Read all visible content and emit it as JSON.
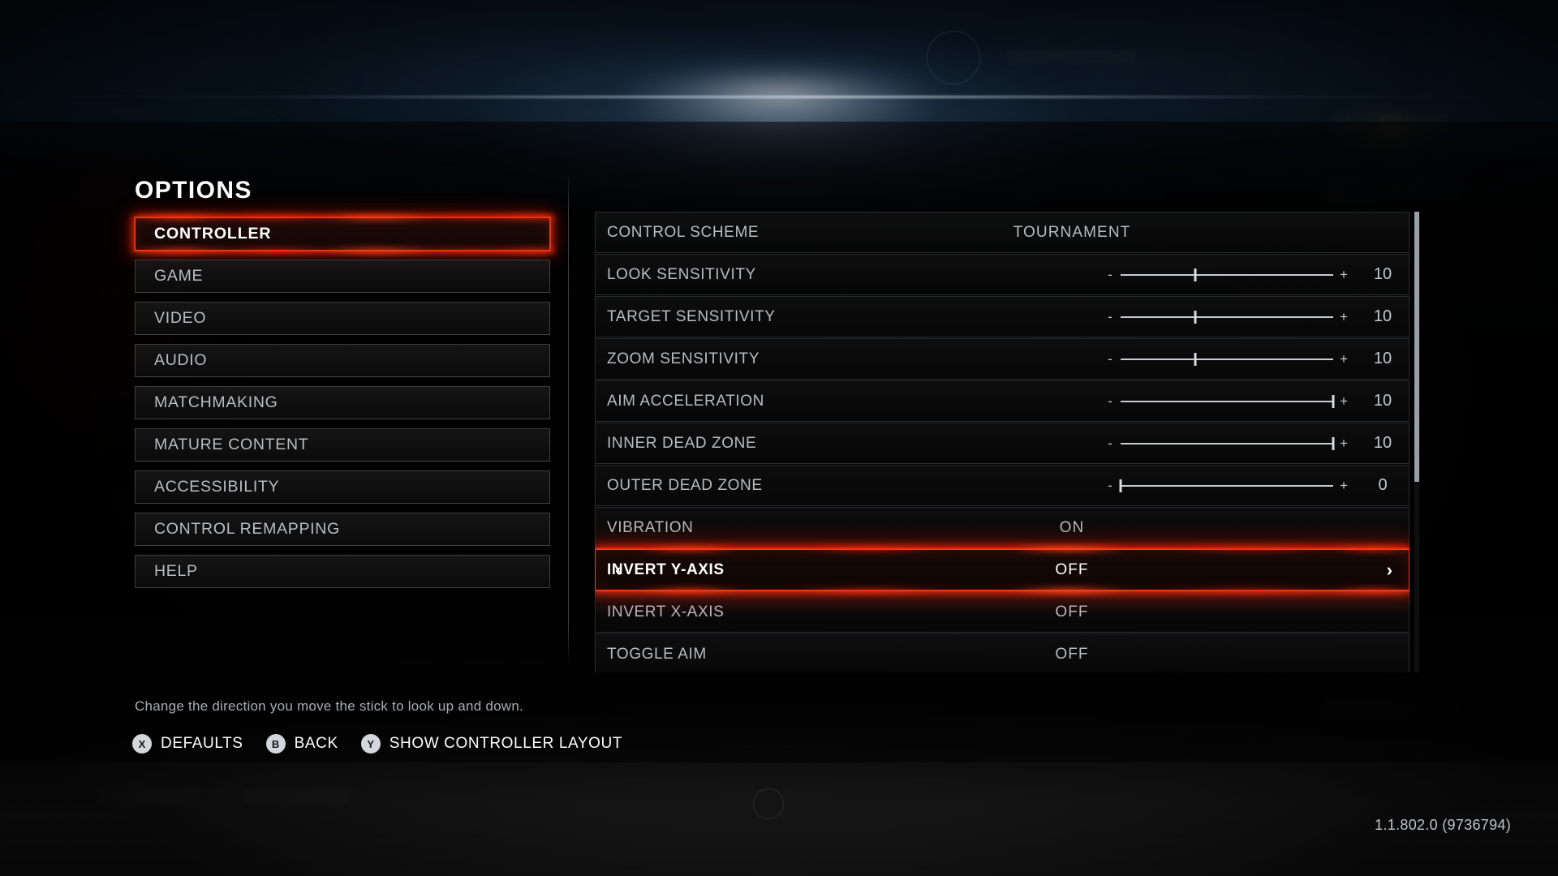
{
  "page_title": "OPTIONS",
  "sidebar": {
    "items": [
      {
        "label": "CONTROLLER",
        "selected": true
      },
      {
        "label": "GAME",
        "selected": false
      },
      {
        "label": "VIDEO",
        "selected": false
      },
      {
        "label": "AUDIO",
        "selected": false
      },
      {
        "label": "MATCHMAKING",
        "selected": false
      },
      {
        "label": "MATURE CONTENT",
        "selected": false
      },
      {
        "label": "ACCESSIBILITY",
        "selected": false
      },
      {
        "label": "CONTROL REMAPPING",
        "selected": false
      },
      {
        "label": "HELP",
        "selected": false
      }
    ]
  },
  "settings": {
    "rows": [
      {
        "name": "CONTROL SCHEME",
        "type": "text",
        "value": "TOURNAMENT",
        "focused": false
      },
      {
        "name": "LOOK SENSITIVITY",
        "type": "slider",
        "value": "10",
        "percent": 35,
        "minus": "-",
        "plus": "+",
        "focused": false
      },
      {
        "name": "TARGET SENSITIVITY",
        "type": "slider",
        "value": "10",
        "percent": 35,
        "minus": "-",
        "plus": "+",
        "focused": false
      },
      {
        "name": "ZOOM SENSITIVITY",
        "type": "slider",
        "value": "10",
        "percent": 35,
        "minus": "-",
        "plus": "+",
        "focused": false
      },
      {
        "name": "AIM ACCELERATION",
        "type": "slider",
        "value": "10",
        "percent": 100,
        "minus": "-",
        "plus": "+",
        "focused": false
      },
      {
        "name": "INNER DEAD ZONE",
        "type": "slider",
        "value": "10",
        "percent": 100,
        "minus": "-",
        "plus": "+",
        "focused": false
      },
      {
        "name": "OUTER DEAD ZONE",
        "type": "slider",
        "value": "0",
        "percent": 0,
        "minus": "-",
        "plus": "+",
        "focused": false
      },
      {
        "name": "VIBRATION",
        "type": "text",
        "value": "ON",
        "focused": false
      },
      {
        "name": "INVERT Y-AXIS",
        "type": "text",
        "value": "OFF",
        "focused": true,
        "chevron_left": "‹",
        "chevron_right": "›"
      },
      {
        "name": "INVERT X-AXIS",
        "type": "text",
        "value": "OFF",
        "focused": false
      },
      {
        "name": "TOGGLE AIM",
        "type": "text",
        "value": "OFF",
        "focused": false
      }
    ]
  },
  "footer": {
    "hint": "Change the direction you move the stick to look up and down.",
    "prompts": [
      {
        "glyph": "X",
        "label": "DEFAULTS"
      },
      {
        "glyph": "B",
        "label": "BACK"
      },
      {
        "glyph": "Y",
        "label": "SHOW CONTROLLER LAYOUT"
      }
    ]
  },
  "version": "1.1.802.0 (9736794)",
  "colors": {
    "accent_red": "#ff3a14",
    "text_primary": "#ffffff",
    "text_secondary": "#b9bcc0"
  }
}
